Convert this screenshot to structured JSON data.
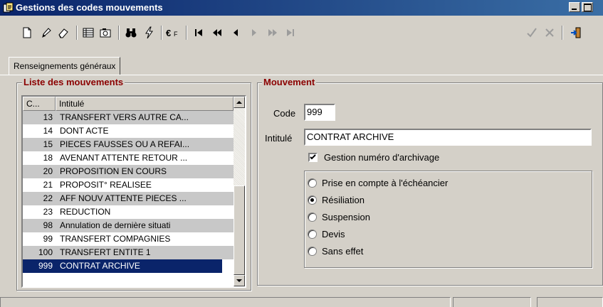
{
  "window": {
    "title": "Gestions des codes mouvements",
    "icon": "app-icon"
  },
  "toolbar": {
    "buttons": [
      {
        "name": "new-document",
        "icon": "new-document-icon"
      },
      {
        "name": "edit",
        "icon": "pencil-icon"
      },
      {
        "name": "erase",
        "icon": "eraser-icon"
      },
      {
        "name": "grid-view",
        "icon": "table-icon"
      },
      {
        "name": "camera",
        "icon": "camera-icon"
      },
      {
        "name": "search",
        "icon": "binoculars-icon"
      },
      {
        "name": "action",
        "icon": "lightning-icon"
      },
      {
        "name": "currency",
        "icon": "euro-franc-icon",
        "text": "€F"
      },
      {
        "name": "first-record",
        "icon": "first-icon"
      },
      {
        "name": "previous-page",
        "icon": "rewind-icon"
      },
      {
        "name": "previous-record",
        "icon": "prev-icon"
      },
      {
        "name": "next-record",
        "icon": "next-icon"
      },
      {
        "name": "next-page",
        "icon": "fastforward-icon"
      },
      {
        "name": "last-record",
        "icon": "last-icon"
      },
      {
        "name": "validate",
        "icon": "check-icon"
      },
      {
        "name": "cancel",
        "icon": "cross-icon"
      },
      {
        "name": "exit",
        "icon": "exit-door-icon"
      }
    ]
  },
  "tabs": [
    {
      "label": "Renseignements généraux"
    }
  ],
  "list_panel": {
    "title": "Liste des mouvements",
    "columns": [
      "C...",
      "Intitulé"
    ],
    "rows": [
      {
        "code": "13",
        "label": "TRANSFERT VERS AUTRE CA...",
        "shade": "grey"
      },
      {
        "code": "14",
        "label": "DONT ACTE",
        "shade": "white"
      },
      {
        "code": "15",
        "label": "PIECES FAUSSES OU A REFAI...",
        "shade": "grey"
      },
      {
        "code": "18",
        "label": "AVENANT ATTENTE RETOUR ...",
        "shade": "white"
      },
      {
        "code": "20",
        "label": "PROPOSITION EN COURS",
        "shade": "grey"
      },
      {
        "code": "21",
        "label": "PROPOSIT° REALISEE",
        "shade": "white"
      },
      {
        "code": "22",
        "label": "AFF NOUV ATTENTE PIECES ...",
        "shade": "grey"
      },
      {
        "code": "23",
        "label": "REDUCTION",
        "shade": "white"
      },
      {
        "code": "98",
        "label": "Annulation de dernière situati",
        "shade": "grey"
      },
      {
        "code": "99",
        "label": "TRANSFERT COMPAGNIES",
        "shade": "white"
      },
      {
        "code": "100",
        "label": "TRANSFERT ENTITE 1",
        "shade": "grey"
      },
      {
        "code": "999",
        "label": "CONTRAT ARCHIVE",
        "shade": "selected"
      }
    ]
  },
  "detail_panel": {
    "title": "Mouvement",
    "code_label": "Code",
    "code_value": "999",
    "intitule_label": "Intitulé",
    "intitule_value": "CONTRAT ARCHIVE",
    "archive_checkbox": {
      "label": "Gestion numéro d'archivage",
      "checked": true
    },
    "radio_options": [
      {
        "label": "Prise en compte à l'échéancier",
        "checked": false
      },
      {
        "label": "Résiliation",
        "checked": true
      },
      {
        "label": "Suspension",
        "checked": false
      },
      {
        "label": "Devis",
        "checked": false
      },
      {
        "label": "Sans effet",
        "checked": false
      }
    ]
  },
  "colors": {
    "title_bar": "#0a246a",
    "group_title": "#8b0000",
    "selection": "#0a246a",
    "row_shade": "#c8c8c8"
  }
}
